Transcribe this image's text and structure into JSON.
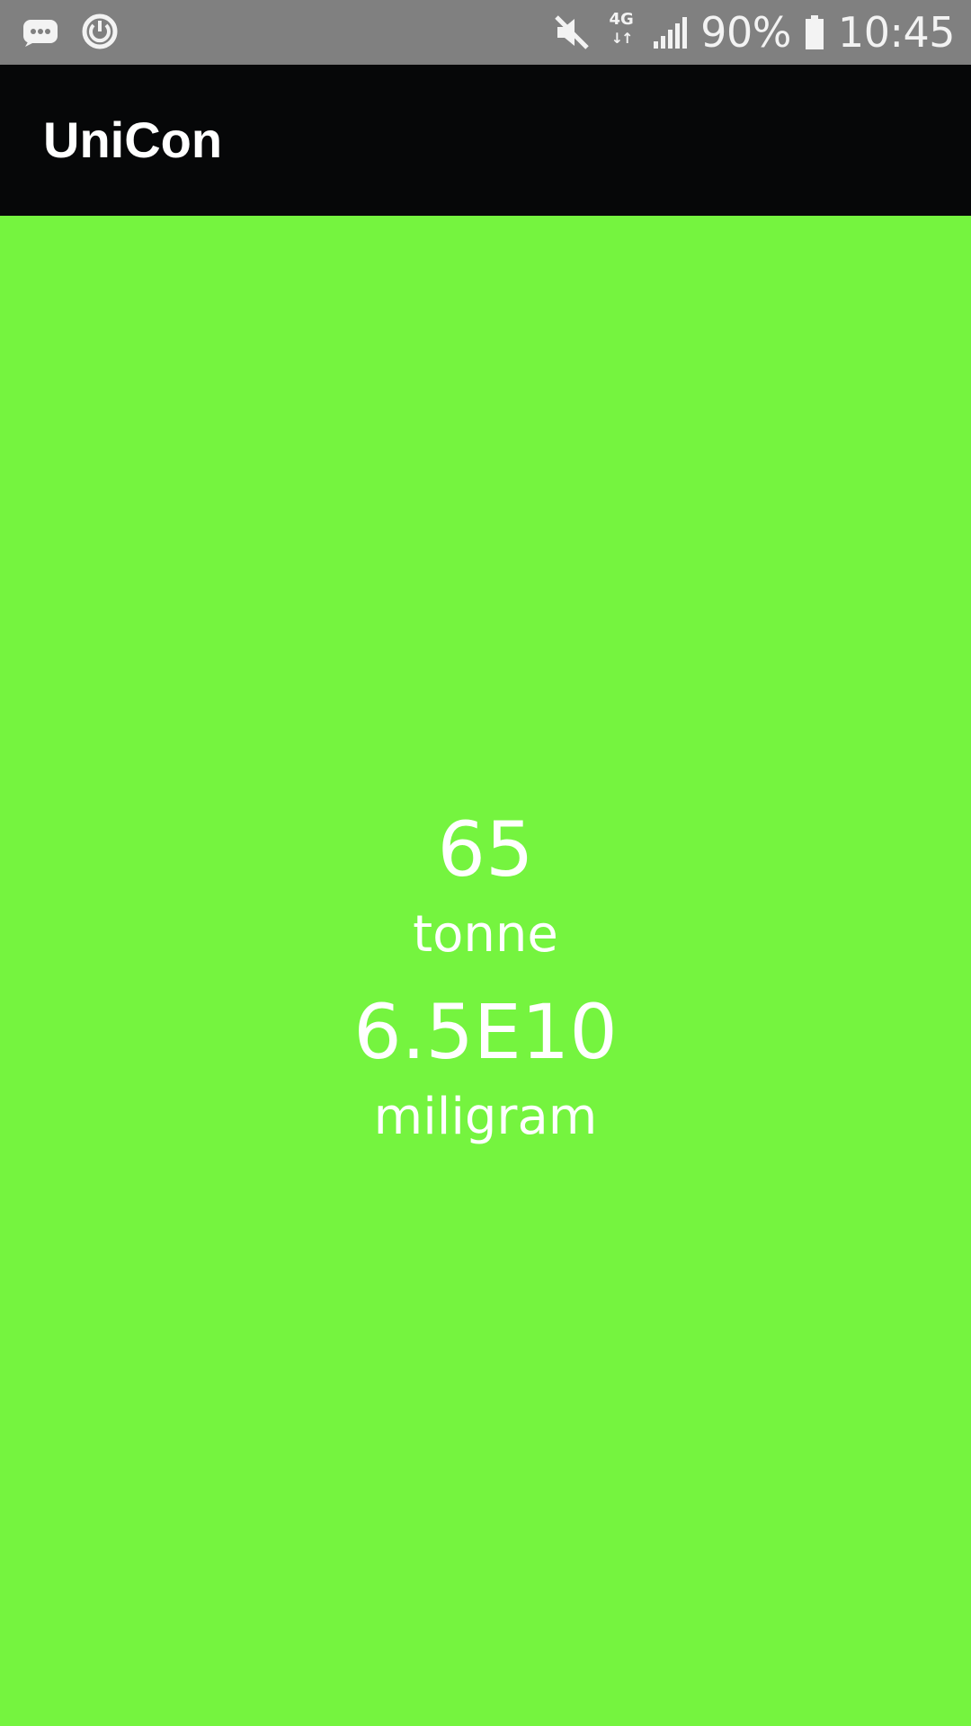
{
  "status_bar": {
    "battery_percent": "90%",
    "time": "10:45",
    "network_type": "4G",
    "icons": [
      "message-notification-icon",
      "sync-icon",
      "volume-muted-icon",
      "network-4g-icon",
      "signal-strength-icon",
      "battery-icon"
    ]
  },
  "app_bar": {
    "title": "UniCon"
  },
  "conversion": {
    "input_value": "65",
    "input_unit": "tonne",
    "output_value": "6.5E10",
    "output_unit": "miligram"
  },
  "colors": {
    "status_bar_background": "#808080",
    "app_bar_background": "#060708",
    "content_background": "#75f43f",
    "text": "#ffffff"
  }
}
